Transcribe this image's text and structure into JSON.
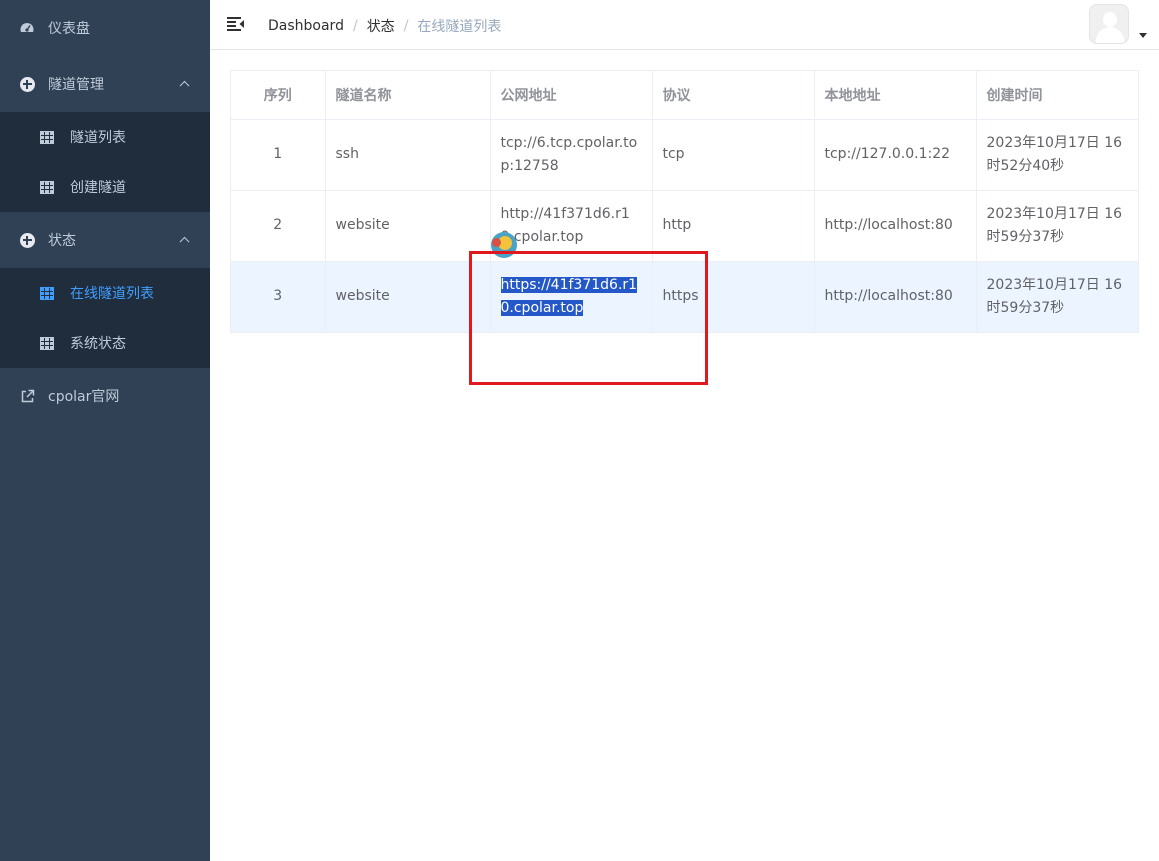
{
  "sidebar": {
    "dashboard": {
      "label": "仪表盘",
      "icon": "dashboard-icon"
    },
    "tunnel_mgmt": {
      "label": "隧道管理",
      "icon": "plus-circle-icon",
      "items": [
        {
          "label": "隧道列表",
          "icon": "table-icon"
        },
        {
          "label": "创建隧道",
          "icon": "table-icon"
        }
      ]
    },
    "status": {
      "label": "状态",
      "icon": "plus-circle-icon",
      "items": [
        {
          "label": "在线隧道列表",
          "icon": "table-icon",
          "active": true
        },
        {
          "label": "系统状态",
          "icon": "table-icon"
        }
      ]
    },
    "website": {
      "label": "cpolar官网",
      "icon": "external-link-icon"
    },
    "colors": {
      "background": "#304156",
      "submenu_background": "#1f2d3d",
      "text": "#bfcbd9",
      "active": "#409eff"
    }
  },
  "navbar": {
    "breadcrumb": [
      "Dashboard",
      "状态",
      "在线隧道列表"
    ],
    "separator": "/"
  },
  "table": {
    "headers": [
      "序列",
      "隧道名称",
      "公网地址",
      "协议",
      "本地地址",
      "创建时间"
    ],
    "rows": [
      [
        "1",
        "ssh",
        "tcp://6.tcp.cpolar.top:12758",
        "tcp",
        "tcp://127.0.0.1:22",
        "2023年10月17日 16时52分40秒"
      ],
      [
        "2",
        "website",
        "http://41f371d6.r10.cpolar.top",
        "http",
        "http://localhost:80",
        "2023年10月17日 16时59分37秒"
      ],
      [
        "3",
        "website",
        "https://41f371d6.r10.cpolar.top",
        "https",
        "http://localhost:80",
        "2023年10月17日 16时59分37秒"
      ]
    ],
    "hovered_row": 2,
    "selected_cell": {
      "row": 2,
      "col": 2
    },
    "colors": {
      "hover": "#ecf5ff",
      "selection": "#2458c8"
    }
  },
  "annotation": {
    "color": "#e0191c"
  }
}
